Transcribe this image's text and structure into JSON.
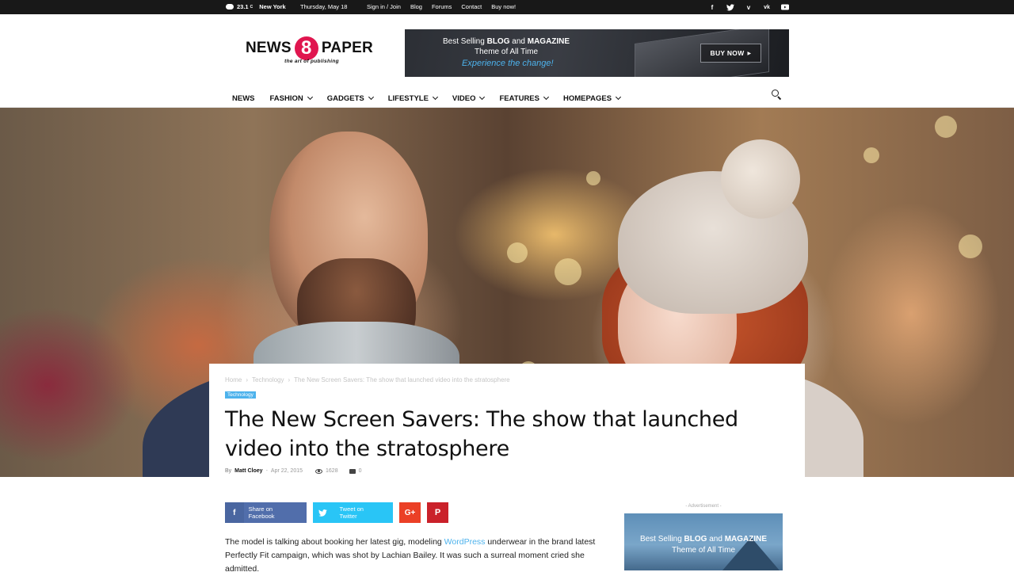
{
  "topbar": {
    "temperature": "23.1",
    "temp_unit": "C",
    "city": "New York",
    "date": "Thursday, May 18",
    "links": [
      "Sign in / Join",
      "Blog",
      "Forums",
      "Contact",
      "Buy now!"
    ],
    "socials": [
      "facebook-icon",
      "twitter-icon",
      "vimeo-icon",
      "vk-icon",
      "youtube-icon"
    ]
  },
  "logo": {
    "word1": "NEWS",
    "number": "8",
    "word2": "PAPER",
    "tagline": "the art of publishing",
    "accent": "#e0164f"
  },
  "banner": {
    "line1_a": "Best Selling ",
    "line1_b": "BLOG",
    "line1_c": " and ",
    "line1_d": "MAGAZINE",
    "line2": "Theme of All Time",
    "line3": "Experience the change!",
    "button": "BUY NOW"
  },
  "nav": {
    "items": [
      {
        "label": "NEWS"
      },
      {
        "label": "FASHION"
      },
      {
        "label": "GADGETS"
      },
      {
        "label": "LIFESTYLE"
      },
      {
        "label": "VIDEO"
      },
      {
        "label": "FEATURES"
      },
      {
        "label": "HOMEPAGES"
      }
    ],
    "active": "FEATURES",
    "accent": "#4db2ec"
  },
  "article": {
    "breadcrumbs": [
      "Home",
      "Technology",
      "The New Screen Savers: The show that launched video into the stratosphere"
    ],
    "category": "Technology",
    "title": "The New Screen Savers: The show that launched video into the stratosphere",
    "by": "By",
    "author": "Matt Cloey",
    "date": "Apr 22, 2015",
    "views": "1628",
    "comments": "0",
    "body_a": "The model is talking about booking her latest gig, modeling ",
    "body_link": "WordPress",
    "body_b": " underwear in the brand latest Perfectly Fit campaign, which was shot by Lachian Bailey. It was such a surreal moment cried she admitted."
  },
  "share": {
    "facebook": "Share on Facebook",
    "twitter": "Tweet on Twitter",
    "colors": {
      "facebook": "#516eab",
      "twitter": "#29c5f6",
      "google": "#eb4026",
      "pinterest": "#ca212a"
    }
  },
  "sidebar": {
    "ad_label": "- Advertisement -",
    "ad_line1_a": "Best Selling ",
    "ad_line1_b": "BLOG",
    "ad_line1_c": " and ",
    "ad_line1_d": "MAGAZINE",
    "ad_line2": "Theme of All Time"
  }
}
